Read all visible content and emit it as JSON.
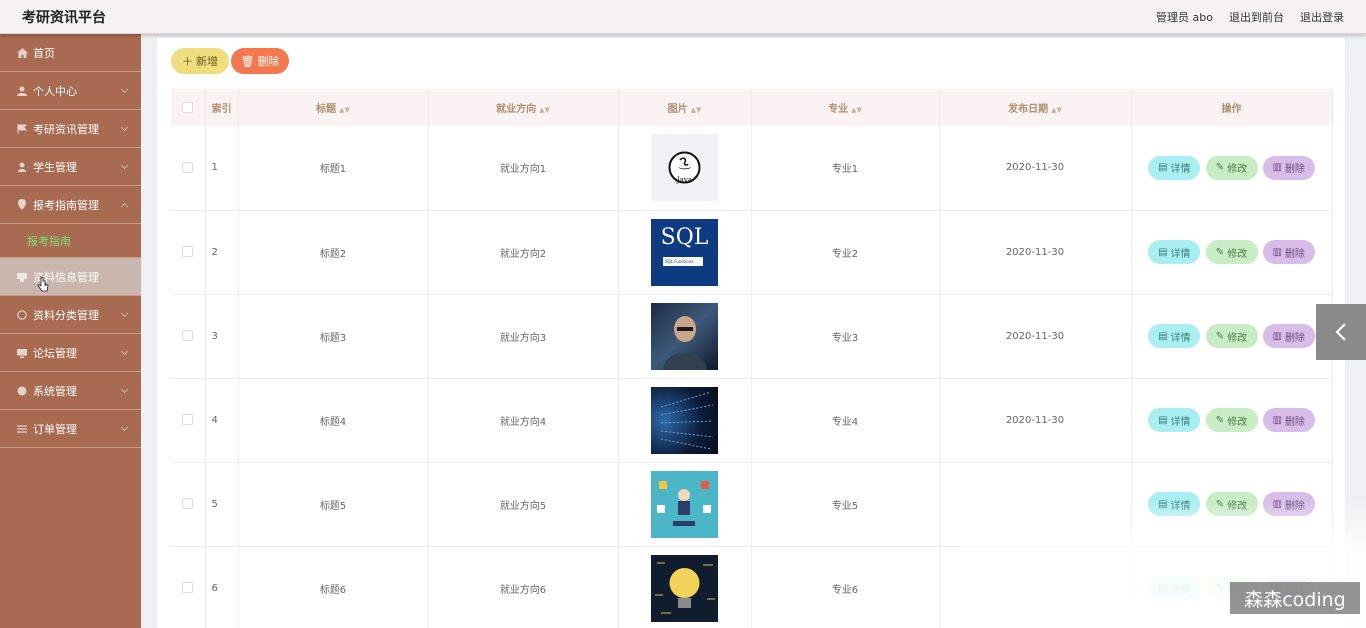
{
  "header": {
    "title": "考研资讯平台",
    "user": "管理员 abo",
    "back_to_front": "退出到前台",
    "logout": "退出登录"
  },
  "sidebar": {
    "items": [
      {
        "label": "首页",
        "icon": "home-icon"
      },
      {
        "label": "个人中心",
        "icon": "user-icon"
      },
      {
        "label": "考研资讯管理",
        "icon": "flag-icon"
      },
      {
        "label": "学生管理",
        "icon": "student-icon"
      },
      {
        "label": "报考指南管理",
        "icon": "location-icon",
        "expanded": true,
        "sub": "报考指南"
      },
      {
        "label": "资料信息管理",
        "icon": "folder-icon"
      },
      {
        "label": "资料分类管理",
        "icon": "clock-icon"
      },
      {
        "label": "论坛管理",
        "icon": "monitor-icon"
      },
      {
        "label": "系统管理",
        "icon": "globe-icon"
      },
      {
        "label": "订单管理",
        "icon": "list-icon"
      }
    ]
  },
  "toolbar": {
    "add_label": "新增",
    "delete_label": "删除"
  },
  "table": {
    "headers": [
      "索引",
      "标题",
      "就业方向",
      "图片",
      "专业",
      "发布日期",
      "操作"
    ],
    "rows": [
      {
        "index": "1",
        "title": "标题1",
        "direction": "就业方向1",
        "major": "专业1",
        "date": "2020-11-30"
      },
      {
        "index": "2",
        "title": "标题2",
        "direction": "就业方向2",
        "major": "专业2",
        "date": "2020-11-30"
      },
      {
        "index": "3",
        "title": "标题3",
        "direction": "就业方向3",
        "major": "专业3",
        "date": "2020-11-30"
      },
      {
        "index": "4",
        "title": "标题4",
        "direction": "就业方向4",
        "major": "专业4",
        "date": "2020-11-30"
      },
      {
        "index": "5",
        "title": "标题5",
        "direction": "就业方向5",
        "major": "专业5",
        "date": ""
      },
      {
        "index": "6",
        "title": "标题6",
        "direction": "就业方向6",
        "major": "专业6",
        "date": ""
      }
    ],
    "actions": {
      "detail": "详情",
      "edit": "修改",
      "remove": "删除"
    },
    "thumb_texts": {
      "java": "Java",
      "sql": "SQL",
      "sql_sub": "SQL Functions"
    }
  },
  "watermark": "森森coding",
  "colors": {
    "sidebar": "#a86a50",
    "add": "#f0de7e",
    "delete": "#f4784d",
    "detail": "#a9eef0",
    "edit": "#c8ecc4",
    "remove": "#d8bde9"
  }
}
